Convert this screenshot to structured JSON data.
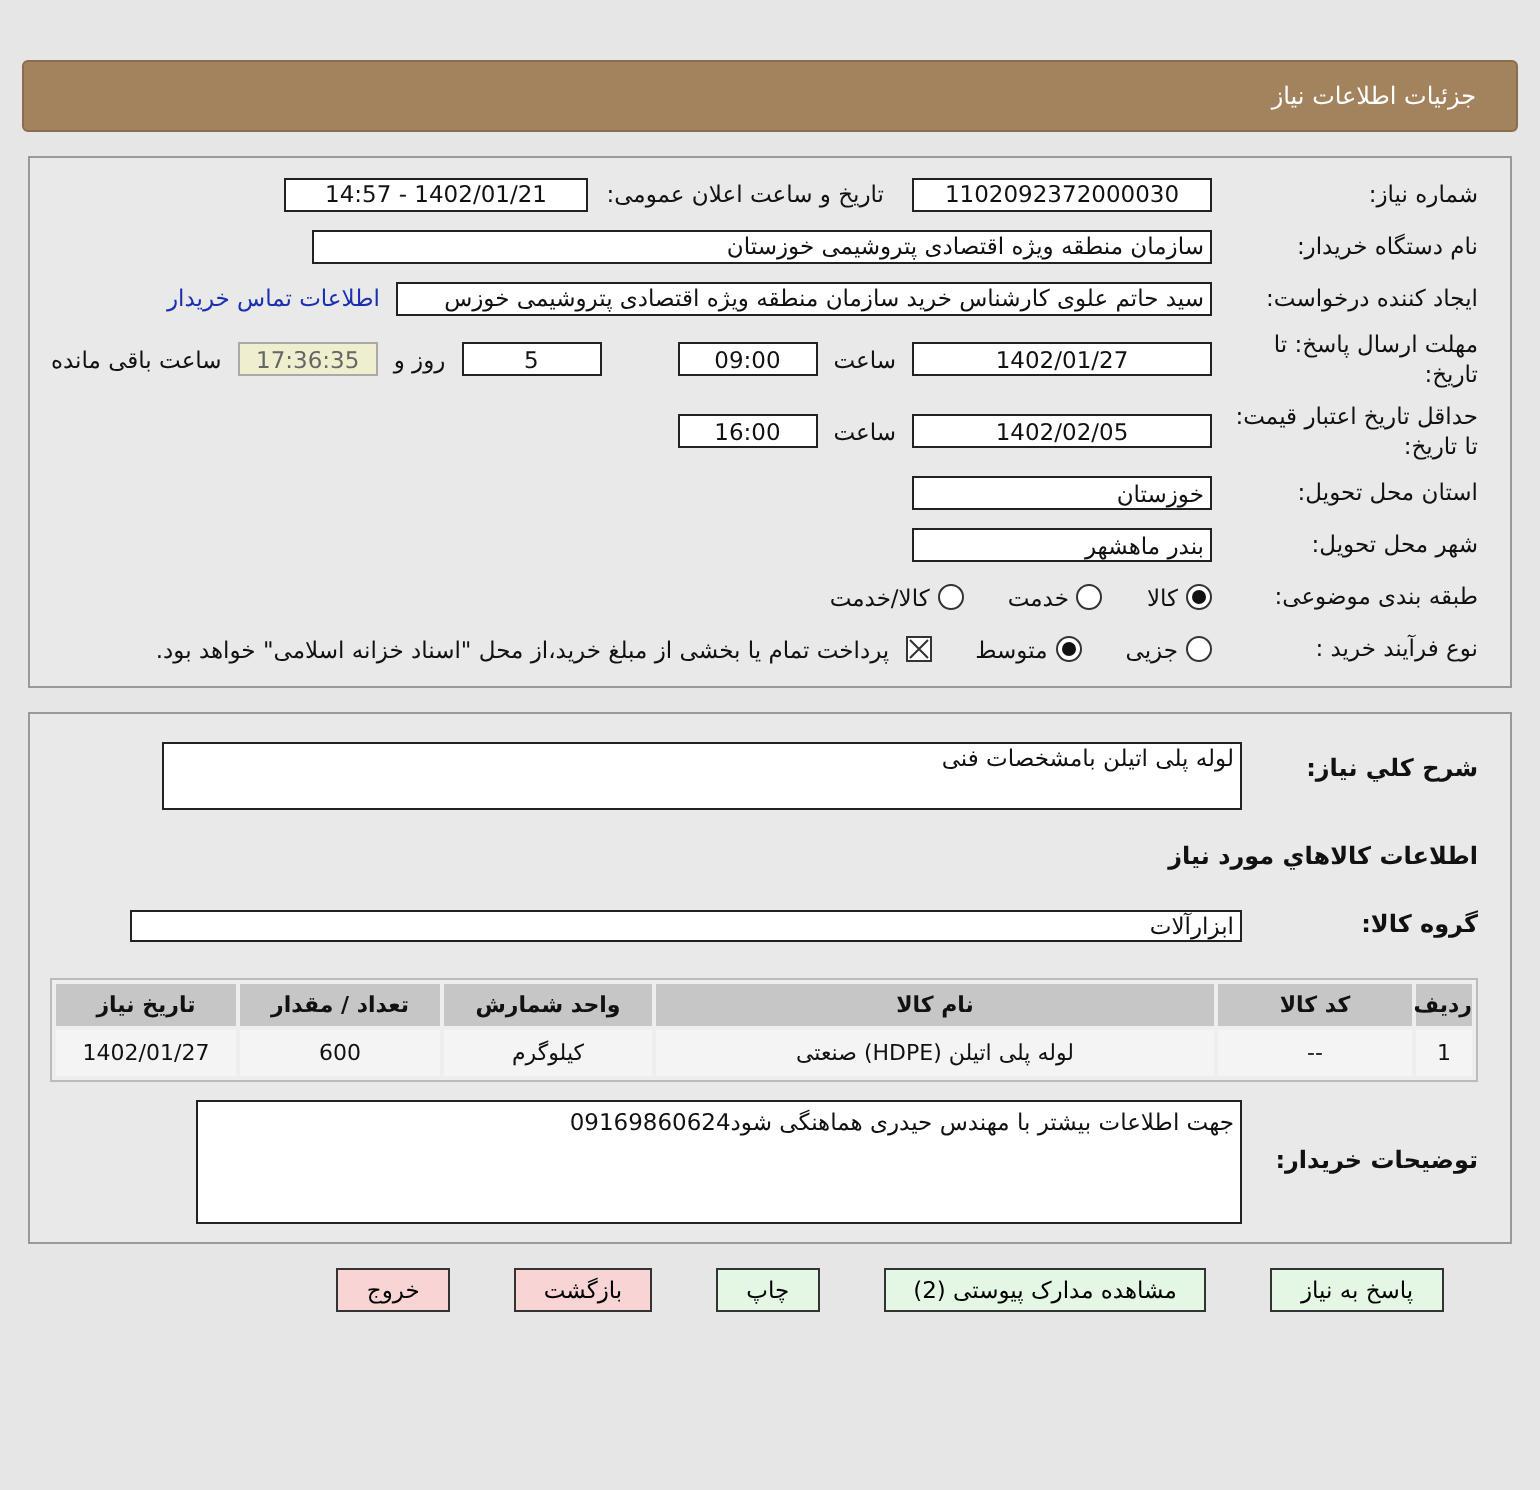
{
  "header": {
    "title": "جزئیات اطلاعات نیاز"
  },
  "need_number": {
    "label": "شماره نیاز:",
    "value": "1102092372000030"
  },
  "announce": {
    "label": "تاریخ و ساعت اعلان عمومی:",
    "value": "1402/01/21 - 14:57"
  },
  "buyer_org": {
    "label": "نام دستگاه خریدار:",
    "value": "سازمان منطقه ویژه اقتصادی پتروشیمی خوزستان"
  },
  "requester": {
    "label": "ایجاد کننده درخواست:",
    "value": "سید حاتم علوی کارشناس خرید سازمان منطقه ویژه اقتصادی پتروشیمی خوزس",
    "link": "اطلاعات تماس خریدار"
  },
  "deadline": {
    "label": "مهلت ارسال پاسخ: تا تاریخ:",
    "date": "1402/01/27",
    "time_label": "ساعت",
    "time": "09:00",
    "days": "5",
    "days_label": "روز و",
    "remaining": "17:36:35",
    "remaining_label": "ساعت باقی مانده"
  },
  "validity": {
    "label": "حداقل تاریخ اعتبار قیمت: تا تاریخ:",
    "date": "1402/02/05",
    "time_label": "ساعت",
    "time": "16:00"
  },
  "province": {
    "label": "استان محل تحویل:",
    "value": "خوزستان"
  },
  "city": {
    "label": "شهر محل تحویل:",
    "value": "بندر ماهشهر"
  },
  "category": {
    "label": "طبقه بندی موضوعی:",
    "options": [
      {
        "label": "کالا",
        "selected": true
      },
      {
        "label": "خدمت",
        "selected": false
      },
      {
        "label": "کالا/خدمت",
        "selected": false
      }
    ]
  },
  "process": {
    "label": "نوع فرآیند خرید :",
    "options": [
      {
        "label": "جزیی",
        "selected": false
      },
      {
        "label": "متوسط",
        "selected": true
      }
    ],
    "treasury": {
      "checked": true,
      "text": "پرداخت تمام یا بخشی از مبلغ خرید،از محل \"اسناد خزانه اسلامی\" خواهد بود."
    }
  },
  "summary": {
    "label": "شرح کلي نياز:",
    "value": "لوله پلی اتیلن بامشخصات فنی"
  },
  "goods_heading": "اطلاعات کالاهاي مورد نياز",
  "goods_group": {
    "label": "گروه کالا:",
    "value": "ابزارآلات"
  },
  "table": {
    "columns": [
      "ردیف",
      "کد کالا",
      "نام کالا",
      "واحد شمارش",
      "تعداد / مقدار",
      "تاریخ نیاز"
    ],
    "rows": [
      [
        "1",
        "--",
        "لوله پلی اتیلن (HDPE) صنعتی",
        "کیلوگرم",
        "600",
        "1402/01/27"
      ]
    ]
  },
  "notes": {
    "label": "توضیحات خریدار:",
    "value": "جهت اطلاعات بیشتر با مهندس حیدری هماهنگی شود09169860624"
  },
  "buttons": [
    {
      "label": "پاسخ به نیاز",
      "kind": "normal"
    },
    {
      "label": "مشاهده مدارک پیوستی (2)",
      "kind": "normal"
    },
    {
      "label": "چاپ",
      "kind": "normal"
    },
    {
      "label": "بازگشت",
      "kind": "danger"
    },
    {
      "label": "خروج",
      "kind": "danger"
    }
  ]
}
